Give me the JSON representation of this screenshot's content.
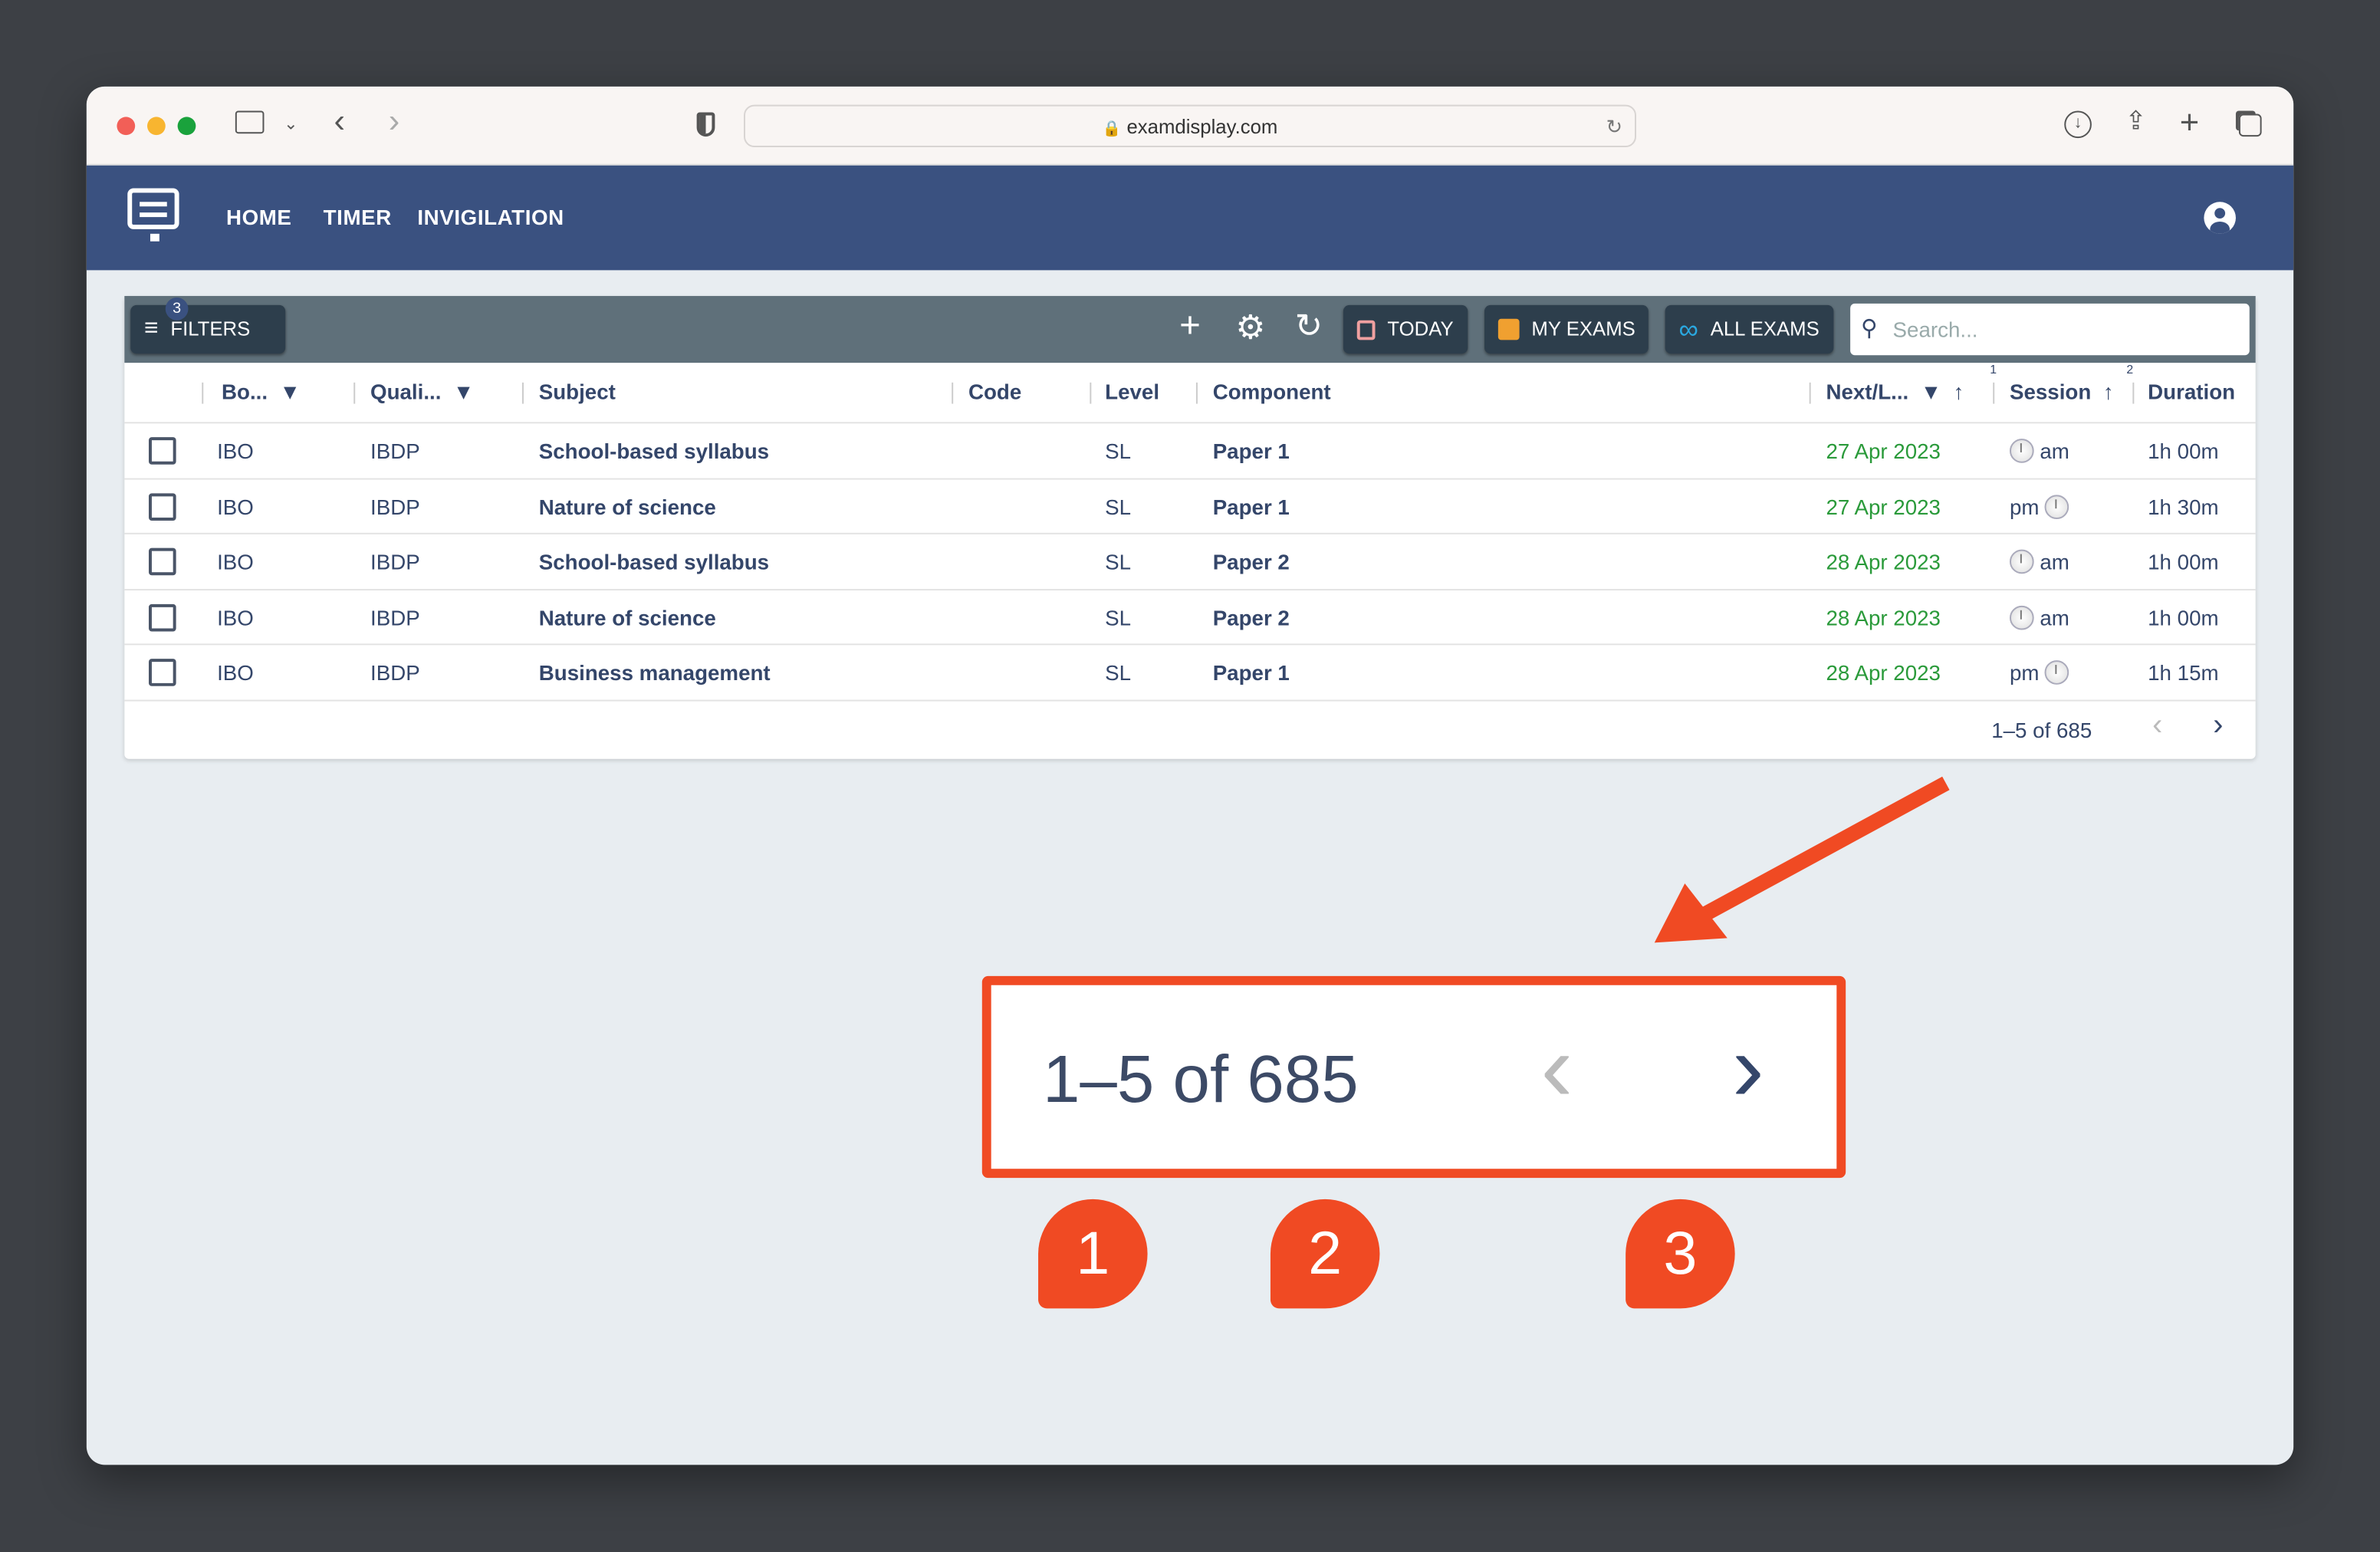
{
  "browser": {
    "url": "examdisplay.com"
  },
  "nav": {
    "items": [
      "HOME",
      "TIMER",
      "INVIGILATION"
    ]
  },
  "toolbar": {
    "filters_label": "FILTERS",
    "filters_badge": "3",
    "today": "TODAY",
    "my_exams": "MY EXAMS",
    "all_exams": "ALL EXAMS",
    "search_placeholder": "Search..."
  },
  "table": {
    "headers": {
      "board": "Bo...",
      "qualification": "Quali...",
      "subject": "Subject",
      "code": "Code",
      "level": "Level",
      "component": "Component",
      "next": "Next/L...",
      "session": "Session",
      "duration": "Duration",
      "sort1": "1",
      "sort2": "2"
    },
    "rows": [
      {
        "board": "IBO",
        "qual": "IBDP",
        "subject": "School-based syllabus",
        "code": "",
        "level": "SL",
        "component": "Paper 1",
        "date": "27 Apr 2023",
        "session": "am",
        "duration": "1h 00m"
      },
      {
        "board": "IBO",
        "qual": "IBDP",
        "subject": "Nature of science",
        "code": "",
        "level": "SL",
        "component": "Paper 1",
        "date": "27 Apr 2023",
        "session": "pm",
        "duration": "1h 30m"
      },
      {
        "board": "IBO",
        "qual": "IBDP",
        "subject": "School-based syllabus",
        "code": "",
        "level": "SL",
        "component": "Paper 2",
        "date": "28 Apr 2023",
        "session": "am",
        "duration": "1h 00m"
      },
      {
        "board": "IBO",
        "qual": "IBDP",
        "subject": "Nature of science",
        "code": "",
        "level": "SL",
        "component": "Paper 2",
        "date": "28 Apr 2023",
        "session": "am",
        "duration": "1h 00m"
      },
      {
        "board": "IBO",
        "qual": "IBDP",
        "subject": "Business management",
        "code": "",
        "level": "SL",
        "component": "Paper 1",
        "date": "28 Apr 2023",
        "session": "pm",
        "duration": "1h 15m"
      }
    ],
    "pagination": "1–5 of 685"
  },
  "callout": {
    "pagination": "1–5 of 685",
    "markers": [
      "1",
      "2",
      "3"
    ],
    "color": "#f04a23"
  },
  "colors": {
    "appbar": "#3a5180",
    "toolbar": "#5f707a",
    "date": "#2a9a3a"
  }
}
